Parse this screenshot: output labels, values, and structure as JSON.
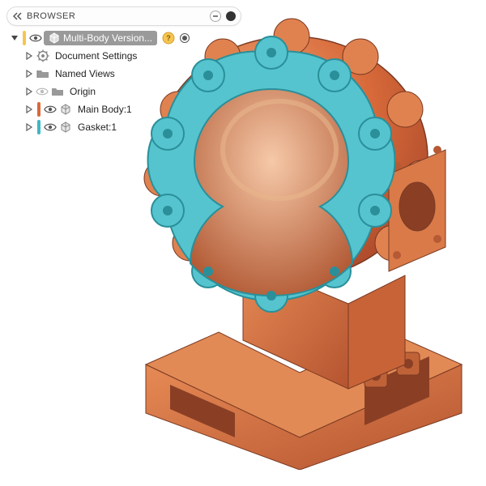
{
  "panel": {
    "title": "BROWSER"
  },
  "tree": {
    "root": {
      "label": "Multi-Body Version..."
    },
    "items": [
      {
        "label": "Document Settings"
      },
      {
        "label": "Named Views"
      },
      {
        "label": "Origin"
      },
      {
        "label": "Main Body:1"
      },
      {
        "label": "Gasket:1"
      }
    ]
  },
  "colors": {
    "body_orange": "#d86a3a",
    "gasket_cyan": "#3fb8c2",
    "root_swatch": "#f6c550"
  }
}
